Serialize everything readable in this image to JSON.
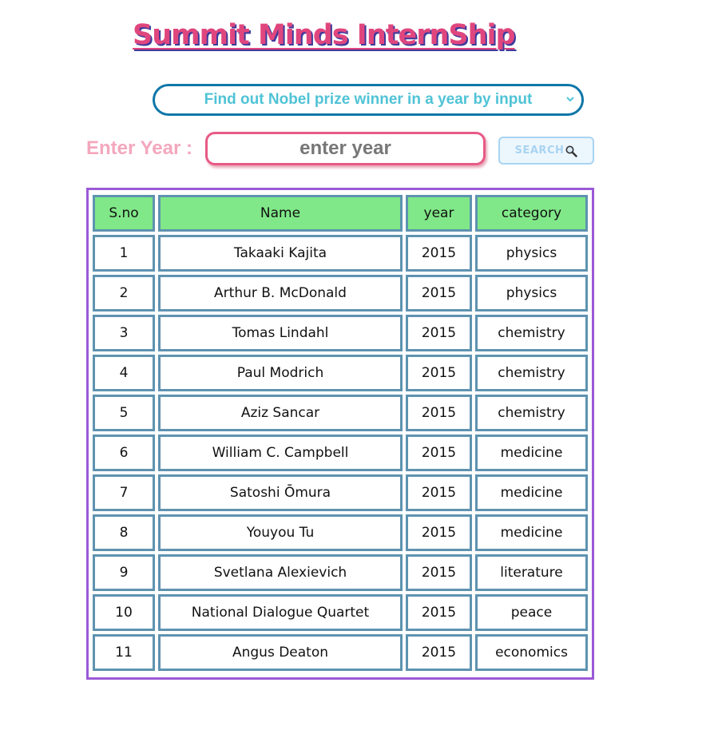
{
  "header": {
    "title": "Summit Minds InternShip"
  },
  "filter": {
    "selected_option": "Find out Nobel prize winner in a year by input"
  },
  "search": {
    "label": "Enter Year :",
    "placeholder": "enter year",
    "value": "",
    "button_label": "SEARCH",
    "button_icon": "magnifier-icon"
  },
  "colors": {
    "title": "#e0467e",
    "title_shadow": "#3d3a9c",
    "select_border": "#0f77a8",
    "select_text": "#4fc3d6",
    "label": "#f4a7bd",
    "input_border": "#e85a86",
    "button_bg": "#ecf6fd",
    "header_bg": "#80e888",
    "cell_border": "#5e93b0",
    "table_border": "#9b59d6"
  },
  "table": {
    "headers": [
      "S.no",
      "Name",
      "year",
      "category"
    ],
    "rows": [
      [
        "1",
        "Takaaki Kajita",
        "2015",
        "physics"
      ],
      [
        "2",
        "Arthur B. McDonald",
        "2015",
        "physics"
      ],
      [
        "3",
        "Tomas Lindahl",
        "2015",
        "chemistry"
      ],
      [
        "4",
        "Paul Modrich",
        "2015",
        "chemistry"
      ],
      [
        "5",
        "Aziz Sancar",
        "2015",
        "chemistry"
      ],
      [
        "6",
        "William C. Campbell",
        "2015",
        "medicine"
      ],
      [
        "7",
        "Satoshi Ōmura",
        "2015",
        "medicine"
      ],
      [
        "8",
        "Youyou Tu",
        "2015",
        "medicine"
      ],
      [
        "9",
        "Svetlana Alexievich",
        "2015",
        "literature"
      ],
      [
        "10",
        "National Dialogue Quartet",
        "2015",
        "peace"
      ],
      [
        "11",
        "Angus Deaton",
        "2015",
        "economics"
      ]
    ]
  }
}
